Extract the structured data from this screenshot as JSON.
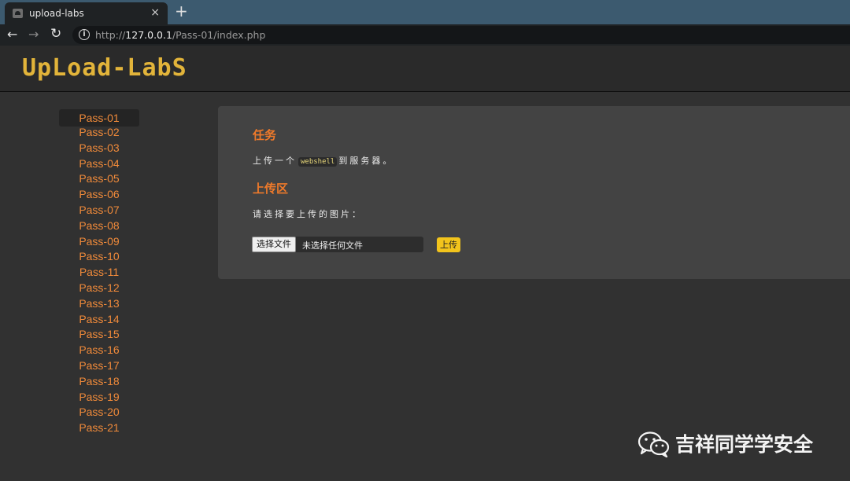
{
  "browser": {
    "tab_title": "upload-labs",
    "tab_close": "×",
    "new_tab": "+",
    "nav_back": "←",
    "nav_forward": "→",
    "nav_reload": "↻",
    "url_prefix": "http://",
    "url_host": "127.0.0.1",
    "url_path": "/Pass-01/index.php",
    "info_glyph": "i"
  },
  "header": {
    "logo_text": "UpLoad-LabS"
  },
  "sidebar": {
    "active_index": 0,
    "items": [
      "Pass-01",
      "Pass-02",
      "Pass-03",
      "Pass-04",
      "Pass-05",
      "Pass-06",
      "Pass-07",
      "Pass-08",
      "Pass-09",
      "Pass-10",
      "Pass-11",
      "Pass-12",
      "Pass-13",
      "Pass-14",
      "Pass-15",
      "Pass-16",
      "Pass-17",
      "Pass-18",
      "Pass-19",
      "Pass-20",
      "Pass-21"
    ]
  },
  "task": {
    "heading": "任务",
    "text_before": "上传一个",
    "code": "webshell",
    "text_after": "到服务器。"
  },
  "upload_area": {
    "heading": "上传区",
    "prompt": "请选择要上传的图片：",
    "choose_file_label": "选择文件",
    "file_status": "未选择任何文件",
    "upload_button": "上传"
  },
  "watermark": {
    "text": "吉祥同学学安全",
    "icon": "wechat-icon"
  },
  "colors": {
    "accent_orange": "#f07a2a",
    "link_orange": "#f08a3a",
    "logo_gold": "#e2b43a",
    "upload_yellow": "#f2c41c",
    "page_bg": "#313131",
    "panel_bg": "#434343"
  }
}
